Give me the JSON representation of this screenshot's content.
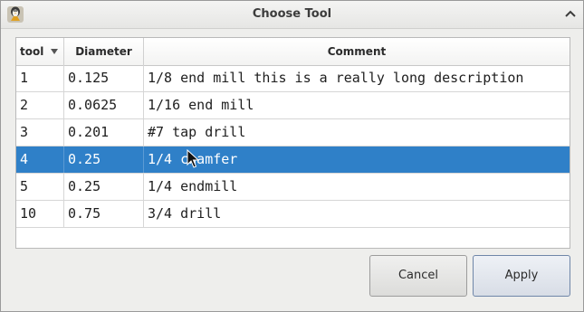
{
  "window": {
    "title": "Choose Tool"
  },
  "table": {
    "headers": {
      "tool": "tool",
      "diameter": "Diameter",
      "comment": "Comment"
    },
    "sort_indicator": "sort-descending-icon",
    "rows": [
      {
        "tool": "1",
        "diameter": "0.125",
        "comment": "1/8 end mill this is a really long description",
        "selected": false
      },
      {
        "tool": "2",
        "diameter": "0.0625",
        "comment": "1/16 end mill",
        "selected": false
      },
      {
        "tool": "3",
        "diameter": "0.201",
        "comment": "#7 tap drill",
        "selected": false
      },
      {
        "tool": "4",
        "diameter": "0.25",
        "comment": "1/4 chamfer",
        "selected": true
      },
      {
        "tool": "5",
        "diameter": "0.25",
        "comment": "1/4 endmill",
        "selected": false
      },
      {
        "tool": "10",
        "diameter": "0.75",
        "comment": "3/4 drill",
        "selected": false
      }
    ]
  },
  "buttons": {
    "cancel": "Cancel",
    "apply": "Apply"
  },
  "colors": {
    "selection": "#2f80c8",
    "window_bg": "#eeeeec"
  }
}
